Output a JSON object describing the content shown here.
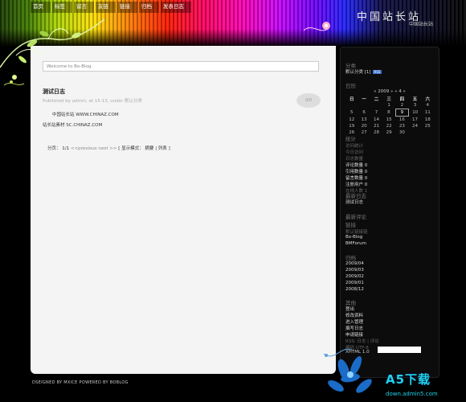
{
  "header": {
    "nav": [
      "首页",
      "标签",
      "留言",
      "友链",
      "链接",
      "归档",
      "发表日志"
    ],
    "site_title": "中国站长站",
    "site_subtitle": "中国站长站"
  },
  "main": {
    "welcome": "Welcome to Bo-Blog.",
    "post": {
      "title": "测试日志",
      "meta": "Published by admin, at 15-13, under 默认分类",
      "comment_count": "0/0",
      "lines": [
        "中国站长站  WWW.CHINAZ.COM",
        "站长站素材  SC.CHINAZ.COM"
      ]
    },
    "pager": {
      "label": "分页：",
      "page": "1/1",
      "prev": "<<previous",
      "next": "next >>",
      "mode_label": "[ 显示模式：",
      "mode_summary": "摘要",
      "mode_sep": "|",
      "mode_list": "列表",
      "mode_end": "]"
    }
  },
  "footer": {
    "text": "DSEIGNED BY MXICE POWERED BY BOBLOG"
  },
  "sidebar": {
    "categories": {
      "heading": "分类",
      "item": "默认分类 [1]",
      "rss": "RSS"
    },
    "calendar": {
      "heading": "日历",
      "nav": "« 2009 »  « 4 »",
      "weekdays": [
        "日",
        "一",
        "二",
        "三",
        "四",
        "五",
        "六"
      ],
      "rows": [
        [
          "",
          "",
          "",
          "1",
          "2",
          "3",
          "4"
        ],
        [
          "5",
          "6",
          "7",
          "8",
          "9",
          "10",
          "11"
        ],
        [
          "12",
          "13",
          "14",
          "15",
          "16",
          "17",
          "18"
        ],
        [
          "19",
          "20",
          "21",
          "22",
          "23",
          "24",
          "25"
        ],
        [
          "26",
          "27",
          "28",
          "29",
          "30",
          "",
          ""
        ]
      ],
      "today": "9"
    },
    "stats": {
      "heading": "统计",
      "items": [
        "访问统计",
        "今日访问",
        "日志数量",
        "评论数量 0",
        "引用数量 0",
        "留言数量 0",
        "注册用户 0",
        "在线人数 1"
      ]
    },
    "latest_posts": {
      "heading": "最新日志",
      "items": [
        "测试日志"
      ]
    },
    "latest_comments": {
      "heading": "最新评论"
    },
    "links": {
      "heading": "链接",
      "items": [
        "默认链接链",
        "Bo-Blog",
        "BMForum"
      ]
    },
    "archives": {
      "heading": "归档",
      "items": [
        "2009/04",
        "2009/03",
        "2009/02",
        "2009/01",
        "2008/12"
      ]
    },
    "misc": {
      "heading": "其他",
      "items": [
        "登出",
        "修改资料",
        "进入管理",
        "撰写日志",
        "申请链接"
      ],
      "rss_line": "RSS: 日志 | 评论",
      "encoding": "编码 UTF-8",
      "xhtml": "XHTML 1.0"
    }
  },
  "watermark": {
    "brand": "A5下载",
    "url": "down.admin5.com"
  },
  "colors": {
    "main_bg": "#f4f4f4",
    "sidebar_bg": "#0c0c0c",
    "logo": "#1fd4e8"
  }
}
